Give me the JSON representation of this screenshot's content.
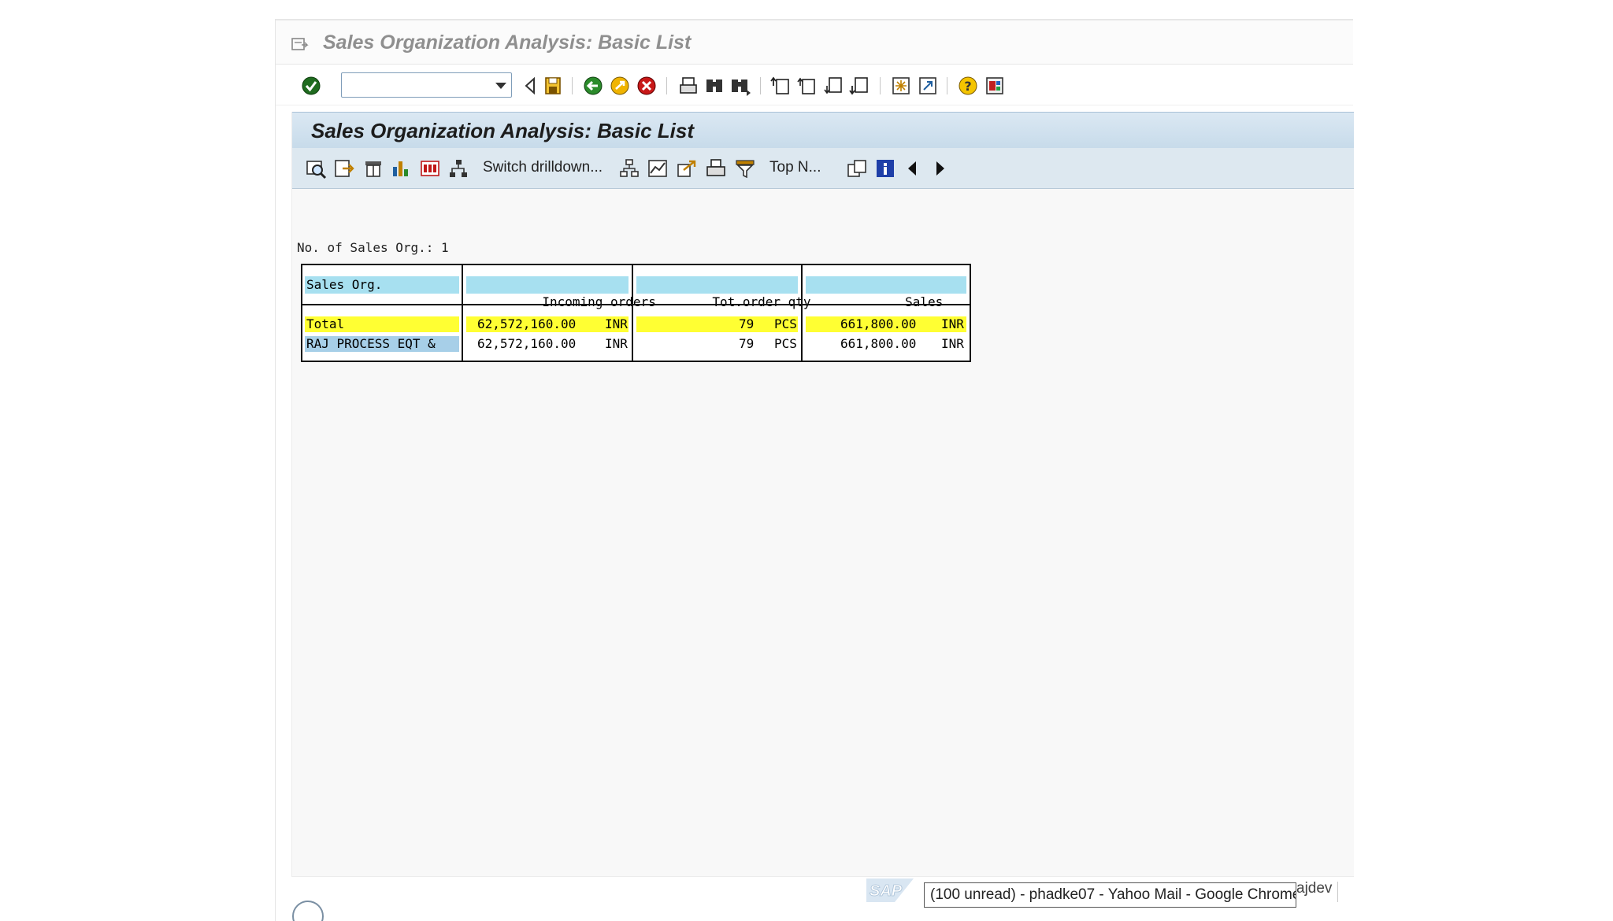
{
  "window": {
    "title": "Sales Organization Analysis: Basic List"
  },
  "toolbar": {
    "command_field": {
      "value": "",
      "placeholder": ""
    }
  },
  "screen": {
    "title": "Sales Organization Analysis: Basic List",
    "app_toolbar": {
      "switch_drilldown": "Switch drilldown...",
      "top_n": "Top N..."
    }
  },
  "report": {
    "count_label": "No. of Sales Org.: 1",
    "columns": [
      "Sales Org.",
      "Incoming orders",
      "Tot.order qty",
      "Sales"
    ],
    "rows": [
      {
        "org": "Total",
        "incoming": "62,572,160.00",
        "incoming_cur": "INR",
        "qty": "79",
        "qty_unit": "PCS",
        "sales": "661,800.00",
        "sales_cur": "INR"
      },
      {
        "org": "RAJ PROCESS EQT &",
        "incoming": "62,572,160.00",
        "incoming_cur": "INR",
        "qty": "79",
        "qty_unit": "PCS",
        "sales": "661,800.00",
        "sales_cur": "INR"
      }
    ]
  },
  "footer": {
    "logo": "SAP",
    "taskbar_tip": "(100 unread) - phadke07 - Yahoo Mail - Google Chrome",
    "user_fragment": "ajdev"
  },
  "colors": {
    "total_highlight": "#ffff33",
    "header_cell": "#a7e0f0",
    "key_cell": "#a7cfe8",
    "title_gray": "#8f8f8f"
  },
  "icons": [
    "menu-icon",
    "enter-icon",
    "back-icon",
    "save-icon",
    "green-back-icon",
    "exit-icon",
    "cancel-icon",
    "print-icon",
    "find-icon",
    "find-next-icon",
    "first-page-icon",
    "previous-page-icon",
    "next-page-icon",
    "last-page-icon",
    "create-session-icon",
    "shortcut-icon",
    "help-icon",
    "layout-icon"
  ]
}
